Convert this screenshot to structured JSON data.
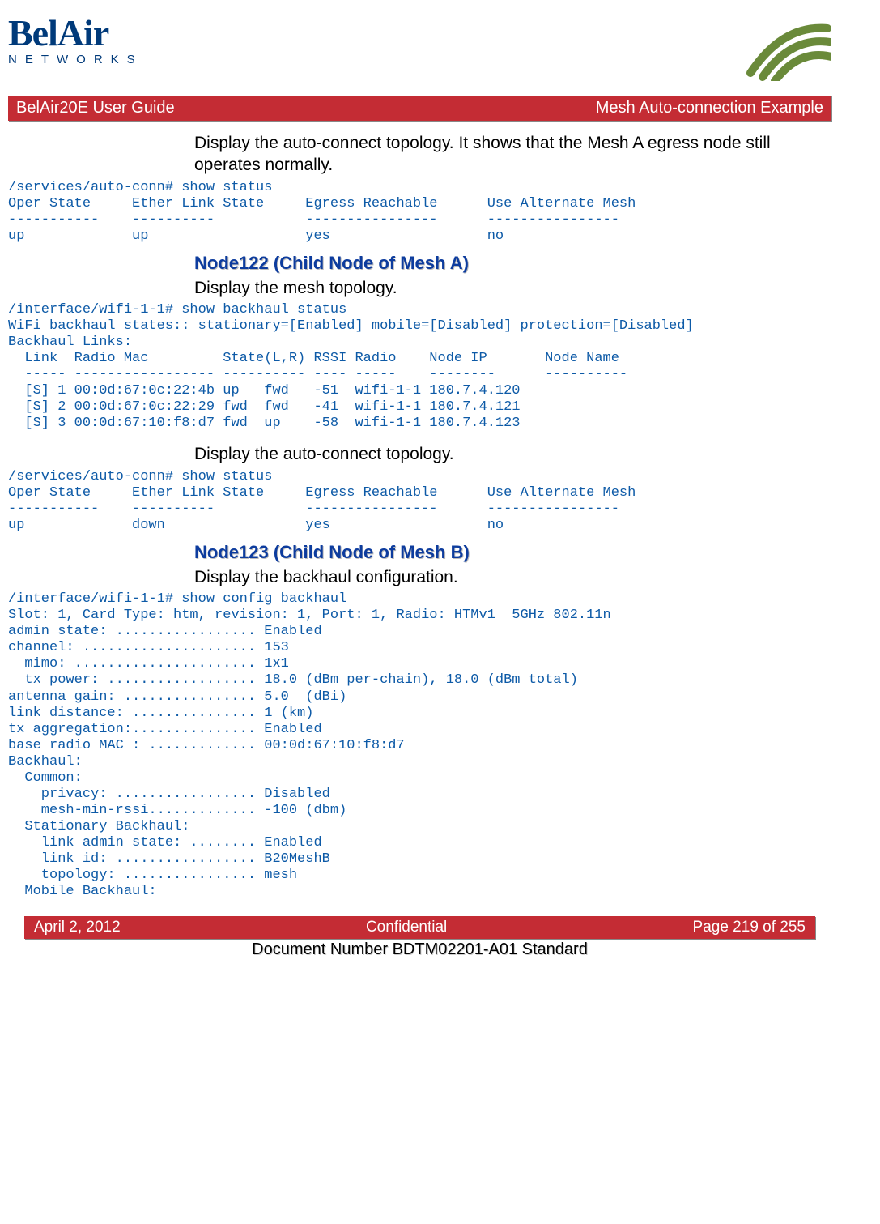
{
  "logo": {
    "line1": "BelAir",
    "line2": "NETWORKS"
  },
  "banner": {
    "left": "BelAir20E User Guide",
    "right": "Mesh Auto-connection Example"
  },
  "p1": "Display the auto-connect topology. It shows that the Mesh A egress node still operates normally.",
  "cli1": "/services/auto-conn# show status\nOper State     Ether Link State     Egress Reachable      Use Alternate Mesh\n-----------    ----------           ----------------      ----------------\nup             up                   yes                   no",
  "h1": "Node122 (Child Node of Mesh A)",
  "p2": "Display the mesh topology.",
  "cli2": "/interface/wifi-1-1# show backhaul status\nWiFi backhaul states:: stationary=[Enabled] mobile=[Disabled] protection=[Disabled]\nBackhaul Links:\n  Link  Radio Mac         State(L,R) RSSI Radio    Node IP       Node Name\n  ----- ----------------- ---------- ---- -----    --------      ----------\n  [S] 1 00:0d:67:0c:22:4b up   fwd   -51  wifi-1-1 180.7.4.120\n  [S] 2 00:0d:67:0c:22:29 fwd  fwd   -41  wifi-1-1 180.7.4.121\n  [S] 3 00:0d:67:10:f8:d7 fwd  up    -58  wifi-1-1 180.7.4.123",
  "p3": "Display the auto-connect topology.",
  "cli3": "/services/auto-conn# show status\nOper State     Ether Link State     Egress Reachable      Use Alternate Mesh\n-----------    ----------           ----------------      ----------------\nup             down                 yes                   no",
  "h2": "Node123 (Child Node of Mesh B)",
  "p4": "Display the backhaul configuration.",
  "cli4": "/interface/wifi-1-1# show config backhaul\nSlot: 1, Card Type: htm, revision: 1, Port: 1, Radio: HTMv1  5GHz 802.11n\nadmin state: ................. Enabled\nchannel: ..................... 153\n  mimo: ...................... 1x1\n  tx power: .................. 18.0 (dBm per-chain), 18.0 (dBm total)\nantenna gain: ................ 5.0  (dBi)\nlink distance: ............... 1 (km)\ntx aggregation:............... Enabled\nbase radio MAC : ............. 00:0d:67:10:f8:d7\nBackhaul:\n  Common:\n    privacy: ................. Disabled\n    mesh-min-rssi............. -100 (dbm)\n  Stationary Backhaul:\n    link admin state: ........ Enabled\n    link id: ................. B20MeshB\n    topology: ................ mesh\n  Mobile Backhaul:",
  "footer": {
    "date": "April 2, 2012",
    "mid": "Confidential",
    "page": "Page 219 of 255"
  },
  "docnum": "Document Number BDTM02201-A01 Standard"
}
